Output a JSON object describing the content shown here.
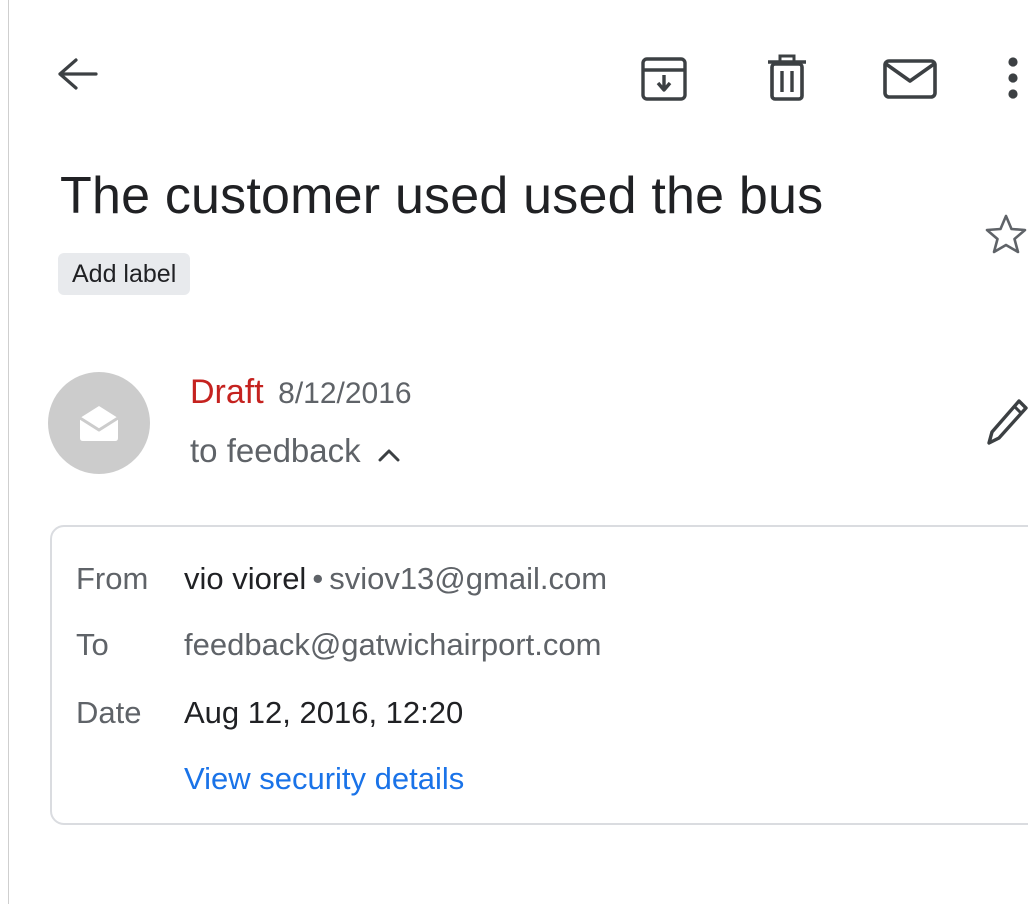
{
  "toolbar": {
    "back_icon": "arrow-left",
    "archive_icon": "archive-down",
    "delete_icon": "trash",
    "mail_icon": "envelope",
    "more_icon": "more-vertical"
  },
  "email": {
    "subject": "The customer used used the bus",
    "add_label": "Add label",
    "star_icon": "star-outline"
  },
  "message": {
    "status": "Draft",
    "date": "8/12/2016",
    "to_summary": "to feedback",
    "edit_icon": "pencil"
  },
  "details": {
    "from_label": "From",
    "from_name": "vio viorel",
    "separator": "•",
    "from_email": "sviov13@gmail.com",
    "to_label": "To",
    "to_email": "feedback@gatwichairport.com",
    "date_label": "Date",
    "date_value": "Aug 12, 2016, 12:20",
    "security_link": "View security details"
  },
  "colors": {
    "draft_red": "#c5221f",
    "link_blue": "#1a73e8",
    "secondary_text": "#5f6368",
    "chip_bg": "#e8eaed"
  }
}
